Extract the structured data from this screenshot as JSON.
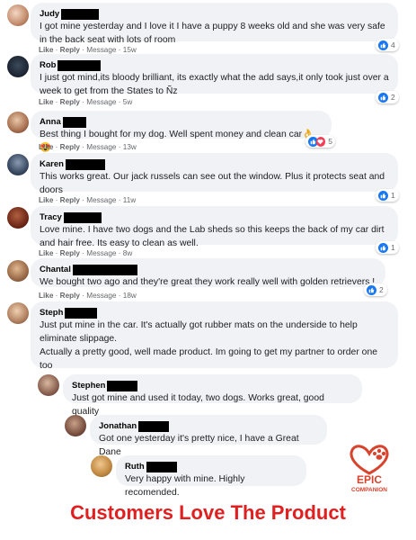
{
  "comments": [
    {
      "name": "Judy",
      "text": "I got mine yesterday and I love it I have a puppy 8 weeks old and she was very safe in the back seat with lots of room",
      "like": "Like",
      "reply": "Reply",
      "message": "Message",
      "time": "15w",
      "reactions": "4",
      "reaction_icons": [
        "like-icon"
      ]
    },
    {
      "name": "Rob",
      "text": "I just got mind,its bloody brilliant, its exactly what the add says,it only took just over a week to get from the States to Ñz",
      "like": "Like",
      "reply": "Reply",
      "message": "Message",
      "time": "5w",
      "reactions": "2",
      "reaction_icons": [
        "like-icon"
      ]
    },
    {
      "name": "Anna",
      "text": "Best thing I bought for my dog. Well spent money and clean car👌😍",
      "like": "Like",
      "reply": "Reply",
      "message": "Message",
      "time": "13w",
      "reactions": "5",
      "reaction_icons": [
        "like-icon",
        "love-icon"
      ]
    },
    {
      "name": "Karen",
      "text": "This works great. Our jack russels can see out the window. Plus it protects seat and doors",
      "like": "Like",
      "reply": "Reply",
      "message": "Message",
      "time": "11w",
      "reactions": "1",
      "reaction_icons": [
        "like-icon"
      ]
    },
    {
      "name": "Tracy",
      "text": "Love mine. I have two dogs and the Lab sheds so this keeps the back of my car dirt and hair free. Its easy to clean as well.",
      "like": "Like",
      "reply": "Reply",
      "message": "Message",
      "time": "8w",
      "reactions": "1",
      "reaction_icons": [
        "like-icon"
      ]
    },
    {
      "name": "Chantal",
      "text": "We bought two ago and they're great they work really well with golden retrievers !",
      "like": "Like",
      "reply": "Reply",
      "message": "Message",
      "time": "18w",
      "reactions": "2",
      "reaction_icons": [
        "like-icon"
      ]
    },
    {
      "name": "Steph",
      "text": "Just put mine in the car. It's actually got rubber mats on the underside to help eliminate slippage.",
      "text2": "Actually a pretty good, well made product. Im going to get my partner to order one too"
    },
    {
      "name": "Stephen",
      "text": "Just got mine and used it today, two dogs. Works great, good quality"
    },
    {
      "name": "Jonathan",
      "text": "Got one yesterday it's pretty nice, I have a Great Dane"
    },
    {
      "name": "Ruth",
      "text": "Very happy with mine. Highly recomended."
    }
  ],
  "footer": "Customers Love The Product",
  "logo": {
    "line1": "EPIC",
    "line2": "COMPANION"
  },
  "colors": {
    "like": "#1877f2",
    "love": "#f33e58",
    "footer": "#e02020",
    "bubble": "#f0f2f5"
  }
}
